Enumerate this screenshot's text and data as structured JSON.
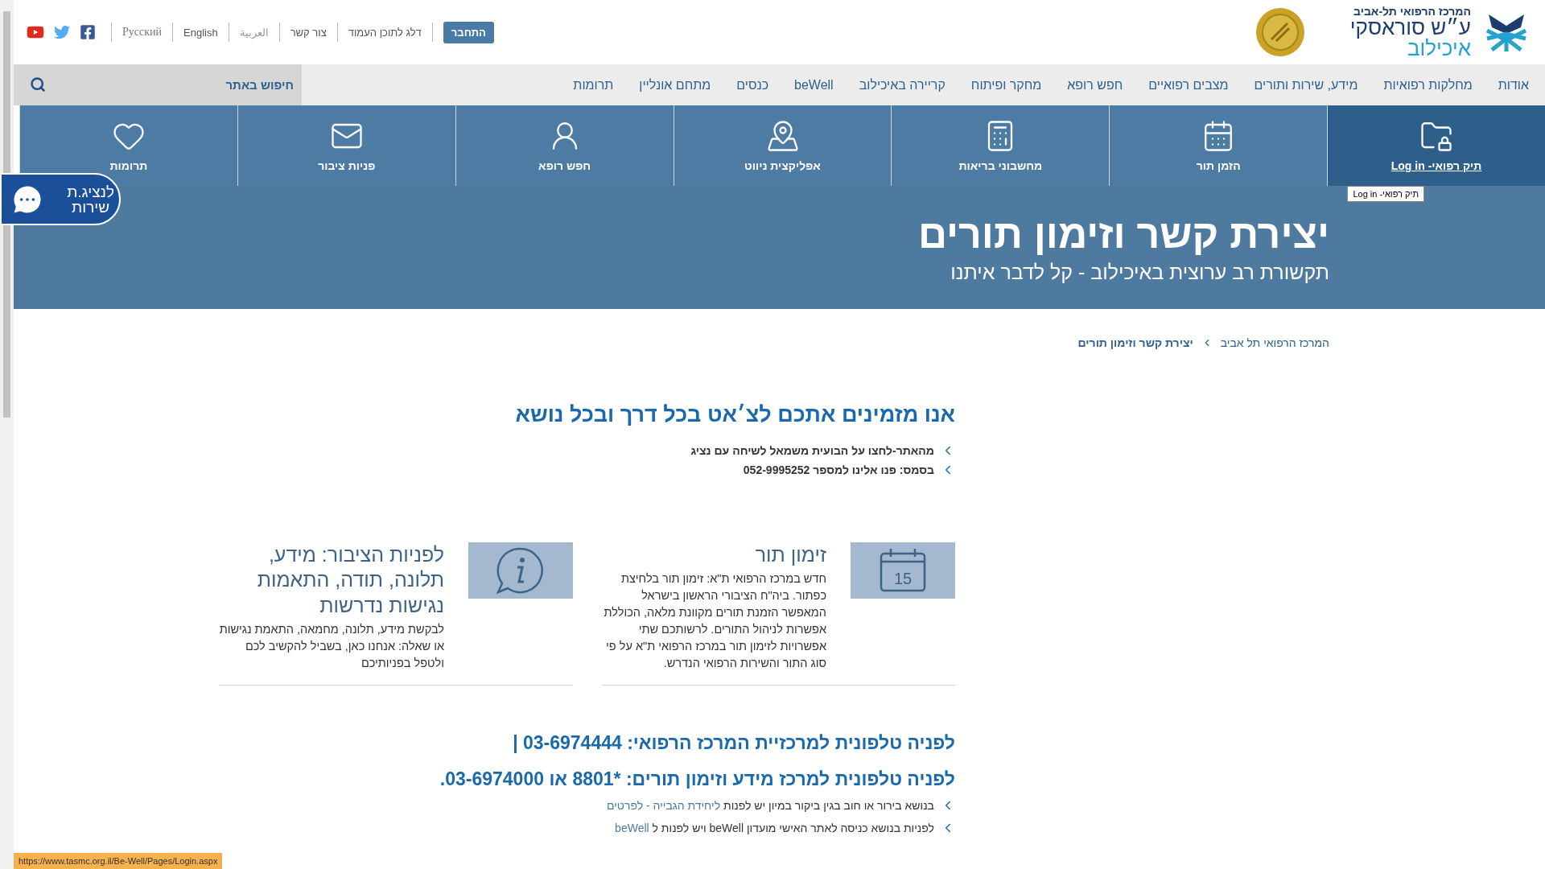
{
  "header": {
    "logo": {
      "line_1": "המרכז הרפואי תל-אביב",
      "line_2": "ע״ש סוראסקי",
      "line_3": "איכילוב"
    },
    "top_links": [
      {
        "label": "התחבר",
        "kind": "button"
      },
      {
        "label": "דלג לתוכן העמוד",
        "kind": "link"
      },
      {
        "label": "צור קשר",
        "kind": "link"
      },
      {
        "label": "العربية",
        "kind": "faded"
      },
      {
        "label": "English",
        "kind": "link"
      },
      {
        "label": "Русский",
        "kind": "serif"
      }
    ]
  },
  "nav": {
    "items": [
      "אודות",
      "מחלקות רפואיות",
      "מידע, שירות ותורים",
      "מצבים רפואיים",
      "חפש רופא",
      "מחקר ופיתוח",
      "קריירה באיכילוב",
      "beWell",
      "כנסים",
      "מתחם אונליין",
      "תרומות"
    ],
    "search": {
      "placeholder": "חיפוש באתר"
    }
  },
  "tiles": [
    {
      "label": "תיק רפואי- Log in",
      "selected": true
    },
    {
      "label": "הזמן תור",
      "selected": false
    },
    {
      "label": "מחשבוני בריאות",
      "selected": false
    },
    {
      "label": "אפליקצית ניווט",
      "selected": false
    },
    {
      "label": "חפש רופא",
      "selected": false
    },
    {
      "label": "פניות ציבור",
      "selected": false
    },
    {
      "label": "תרומות",
      "selected": false
    }
  ],
  "tooltip": "תיק רפואי- Log in",
  "chat_button": {
    "lines": [
      "לנציג.ת",
      "שירות"
    ]
  },
  "hero": {
    "title": "יצירת קשר וזימון תורים",
    "subtitle": "תקשורת רב ערוצית באיכילוב - קל לדבר איתנו"
  },
  "breadcrumb": [
    "המרכז הרפואי תל אביב",
    "יצירת קשר וזימון תורים"
  ],
  "chat_section": {
    "heading": "אנו מזמינים אתכם לצ׳אט בכל דרך ובכל נושא",
    "bullets": [
      "מהאתר-לחצו על הבועית משמאל לשיחה עם נציג",
      "בסמס: פנו אלינו למספר 052-9995252"
    ]
  },
  "cards": [
    {
      "kind": "calendar",
      "icon_label": "15",
      "title": "זימון תור",
      "text": "חדש במרכז הרפואי ת\"א: זימון תור בלחיצת כפתור. ביה\"ח הציבורי הראשון בישראל המאפשר הזמנת תורים מקוונת מלאה, הכוללת אפשרות לניהול התורים. לרשותכם שתי אפשרויות לזימון תור במרכז הרפואי ת\"א על פי סוג התור והשירות הרפואי הנדרש."
    },
    {
      "kind": "info",
      "title": "לפניות הציבור: מידע, תלונה, תודה, התאמות נגישות נדרשות",
      "text": "לבקשת מידע, תלונה, מחמאה, התאמת נגישות או שאלה: אנחנו כאן, בשביל להקשיב לכם ולטפל בפניותיכם"
    }
  ],
  "phones": [
    "לפניה טלפונית למרכזיית המרכז הרפואי: 03-6974444 |",
    "לפניה טלפונית למרכז מידע וזימון תורים: *8801 או 03-6974000."
  ],
  "phone_bullets": [
    {
      "text": "בנושא בירור או חוב בגין ביקור במיון יש לפנות",
      "link": "ליחידת הגבייה - לפרטים"
    },
    {
      "text": "לפניות בנושא כניסה לאתר האישי מועדון beWell ויש לפנות ל",
      "link": "beWell"
    }
  ],
  "status_bar": "https://www.tasmc.org.il/Be-Well/Pages/Login.aspx"
}
